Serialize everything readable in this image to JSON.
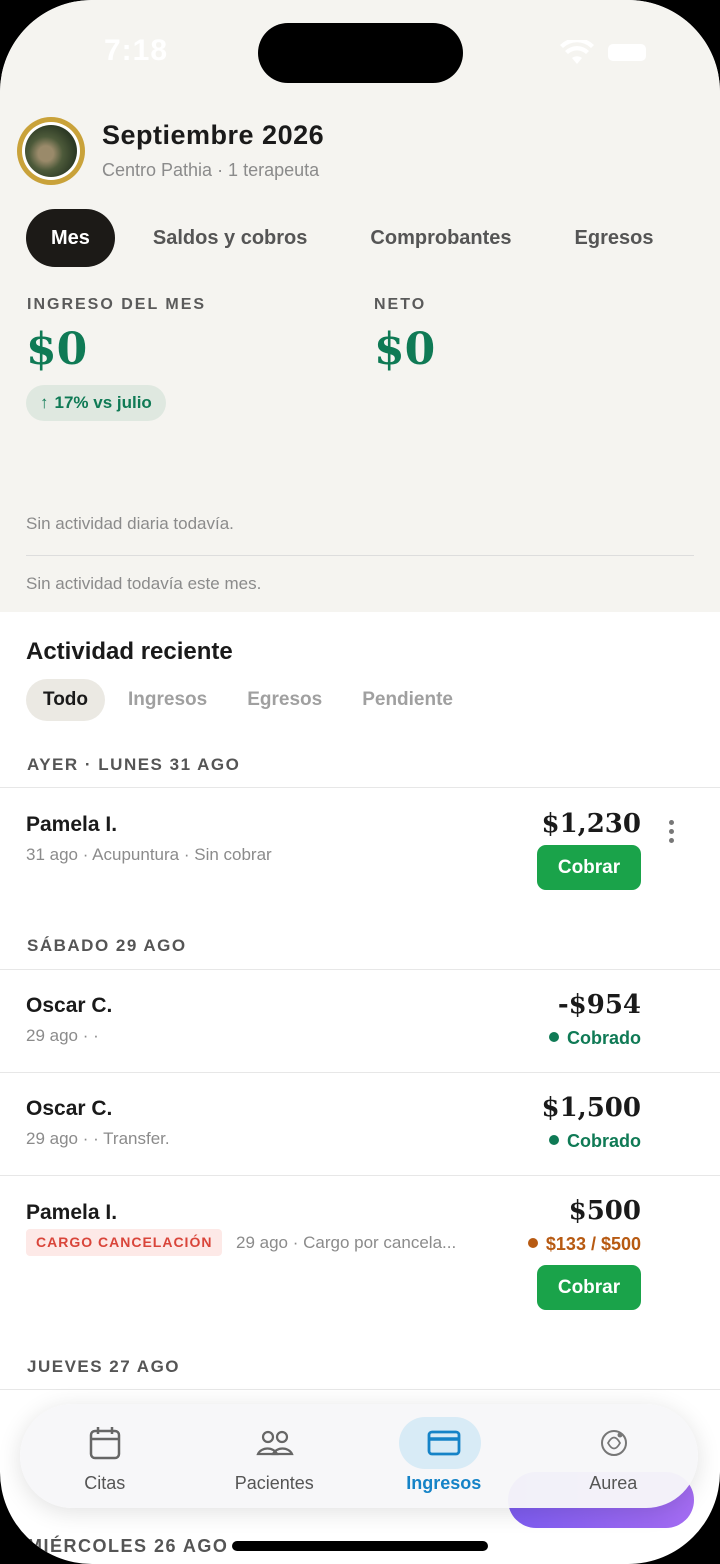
{
  "status_bar": {
    "time": "7:18"
  },
  "header": {
    "title": "Septiembre 2026",
    "subtitle": "Centro Pathia · 1 terapeuta"
  },
  "tabs": [
    {
      "label": "Mes",
      "active": true
    },
    {
      "label": "Saldos y cobros",
      "active": false
    },
    {
      "label": "Comprobantes",
      "active": false
    },
    {
      "label": "Egresos",
      "active": false
    }
  ],
  "kpis": {
    "income_label": "INGRESO DEL MES",
    "income_value": "$0",
    "income_change": "17% vs julio",
    "net_label": "NETO",
    "net_value": "$0"
  },
  "empty_states": {
    "daily": "Sin actividad diaria todavía.",
    "monthly": "Sin actividad todavía este mes."
  },
  "activity": {
    "title": "Actividad reciente",
    "filters": [
      {
        "label": "Todo",
        "active": true
      },
      {
        "label": "Ingresos",
        "active": false
      },
      {
        "label": "Egresos",
        "active": false
      },
      {
        "label": "Pendiente",
        "active": false
      }
    ],
    "groups": [
      {
        "label": "AYER · LUNES 31 AGO",
        "rows": [
          {
            "name": "Pamela I.",
            "meta": "31 ago · Acupuntura · Sin cobrar",
            "amount": "$1,230",
            "action": "Cobrar"
          }
        ]
      },
      {
        "label": "SÁBADO 29 AGO",
        "rows": [
          {
            "name": "Oscar C.",
            "meta": "29 ago ·  ·",
            "amount": "-$954",
            "status": "Cobrado"
          },
          {
            "name": "Oscar C.",
            "meta": "29 ago ·  · Transfer.",
            "amount": "$1,500",
            "status": "Cobrado"
          },
          {
            "name": "Pamela I.",
            "tag": "CARGO CANCELACIÓN",
            "meta": "29 ago · Cargo por cancela...",
            "amount": "$500",
            "status": "$133 / $500",
            "action": "Cobrar"
          }
        ]
      },
      {
        "label": "JUEVES 27 AGO",
        "rows": []
      },
      {
        "label": "MIÉRCOLES 26 AGO",
        "rows": []
      }
    ]
  },
  "bottom_nav": [
    {
      "label": "Citas",
      "icon": "calendar-icon",
      "active": false
    },
    {
      "label": "Pacientes",
      "icon": "people-icon",
      "active": false
    },
    {
      "label": "Ingresos",
      "icon": "card-icon",
      "active": true
    },
    {
      "label": "Aurea",
      "icon": "aurea-icon",
      "active": false
    }
  ],
  "colors": {
    "accent_green": "#0f7a55",
    "button_green": "#1aa34a",
    "pending_orange": "#b75a12",
    "nav_active_blue": "#1583c7",
    "tag_red": "#d9453a"
  }
}
